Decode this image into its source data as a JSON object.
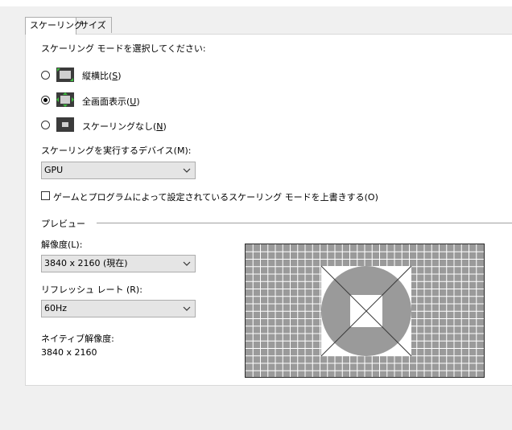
{
  "tabs": [
    {
      "label": "スケーリング",
      "active": true
    },
    {
      "label": "サイズ",
      "active": false
    }
  ],
  "scaling_mode": {
    "prompt": "スケーリング モードを選択してください:",
    "options": [
      {
        "label": "縦横比(",
        "key": "S",
        "suffix": ")",
        "icon": "aspect-ratio-icon",
        "selected": false
      },
      {
        "label": "全画面表示(",
        "key": "U",
        "suffix": ")",
        "icon": "fullscreen-icon",
        "selected": true
      },
      {
        "label": "スケーリングなし(",
        "key": "N",
        "suffix": ")",
        "icon": "no-scaling-icon",
        "selected": false
      }
    ]
  },
  "device": {
    "label": "スケーリングを実行するデバイス(M):",
    "value": "GPU"
  },
  "override": {
    "label": "ゲームとプログラムによって設定されているスケーリング モードを上書きする(O)",
    "checked": false
  },
  "preview": {
    "heading": "プレビュー",
    "resolution_label": "解像度(L):",
    "resolution_value": "3840 x 2160 (現在)",
    "refresh_label": "リフレッシュ レート (R):",
    "refresh_value": "60Hz",
    "native_label": "ネイティブ解像度:",
    "native_value": "3840 x 2160"
  },
  "colors": {
    "preview_bg": "#9a9a9a",
    "grid_line": "#ffffff",
    "panel_bg": "#ffffff",
    "window_bg": "#f0f0f0"
  }
}
